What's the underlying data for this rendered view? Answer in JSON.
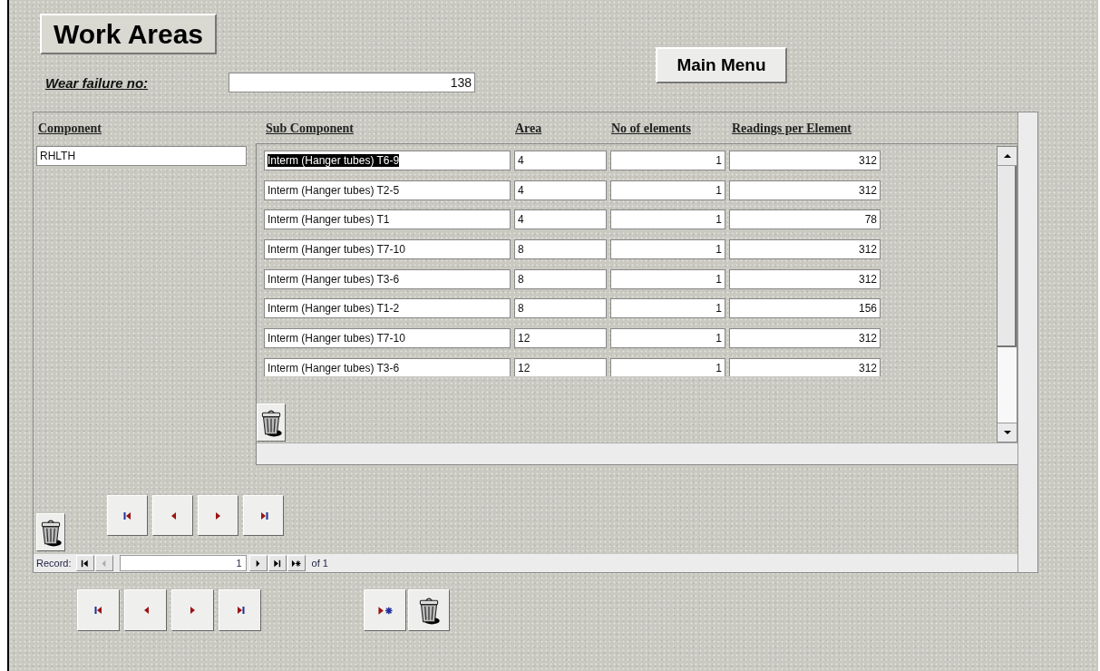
{
  "title": "Work Areas",
  "main_menu": "Main Menu",
  "wear_failure": {
    "label": "Wear failure no:",
    "value": "138"
  },
  "columns": [
    "Component",
    "Sub Component",
    "Area",
    "No of elements",
    "Readings per Element"
  ],
  "component": "RHLTH",
  "rows": [
    {
      "sub_component": "Interm (Hanger tubes) T6-9",
      "area": "4",
      "elements": "1",
      "readings": "312",
      "selected": true
    },
    {
      "sub_component": "Interm (Hanger tubes) T2-5",
      "area": "4",
      "elements": "1",
      "readings": "312",
      "selected": false
    },
    {
      "sub_component": "Interm (Hanger tubes) T1",
      "area": "4",
      "elements": "1",
      "readings": "78",
      "selected": false
    },
    {
      "sub_component": "Interm (Hanger tubes) T7-10",
      "area": "8",
      "elements": "1",
      "readings": "312",
      "selected": false
    },
    {
      "sub_component": "Interm (Hanger tubes) T3-6",
      "area": "8",
      "elements": "1",
      "readings": "312",
      "selected": false
    },
    {
      "sub_component": "Interm (Hanger tubes) T1-2",
      "area": "8",
      "elements": "1",
      "readings": "156",
      "selected": false
    },
    {
      "sub_component": "Interm (Hanger tubes) T7-10",
      "area": "12",
      "elements": "1",
      "readings": "312",
      "selected": false
    },
    {
      "sub_component": "Interm (Hanger tubes) T3-6",
      "area": "12",
      "elements": "1",
      "readings": "312",
      "selected": false
    }
  ],
  "record_bar": {
    "label": "Record:",
    "current": "1",
    "total": "of 1"
  }
}
